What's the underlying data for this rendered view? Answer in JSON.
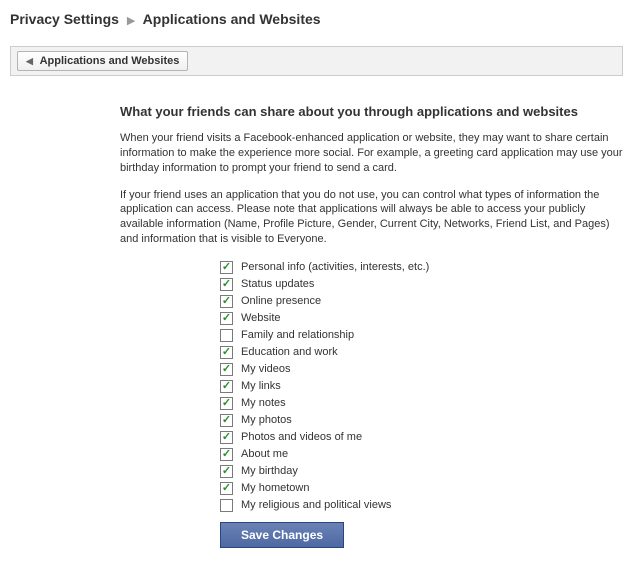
{
  "breadcrumb": {
    "parent": "Privacy Settings",
    "current": "Applications and Websites"
  },
  "tab": {
    "label": "Applications and Websites"
  },
  "main": {
    "heading": "What your friends can share about you through applications and websites",
    "para1": "When your friend visits a Facebook-enhanced application or website, they may want to share certain information to make the experience more social. For example, a greeting card application may use your birthday information to prompt your friend to send a card.",
    "para2": "If your friend uses an application that you do not use, you can control what types of information the application can access. Please note that applications will always be able to access your publicly available information (Name, Profile Picture, Gender, Current City, Networks, Friend List, and Pages) and information that is visible to Everyone."
  },
  "options": [
    {
      "label": "Personal info (activities, interests, etc.)",
      "checked": true
    },
    {
      "label": "Status updates",
      "checked": true
    },
    {
      "label": "Online presence",
      "checked": true
    },
    {
      "label": "Website",
      "checked": true
    },
    {
      "label": "Family and relationship",
      "checked": false
    },
    {
      "label": "Education and work",
      "checked": true
    },
    {
      "label": "My videos",
      "checked": true
    },
    {
      "label": "My links",
      "checked": true
    },
    {
      "label": "My notes",
      "checked": true
    },
    {
      "label": "My photos",
      "checked": true
    },
    {
      "label": "Photos and videos of me",
      "checked": true
    },
    {
      "label": "About me",
      "checked": true
    },
    {
      "label": "My birthday",
      "checked": true
    },
    {
      "label": "My hometown",
      "checked": true
    },
    {
      "label": "My religious and political views",
      "checked": false
    }
  ],
  "buttons": {
    "save": "Save Changes"
  }
}
